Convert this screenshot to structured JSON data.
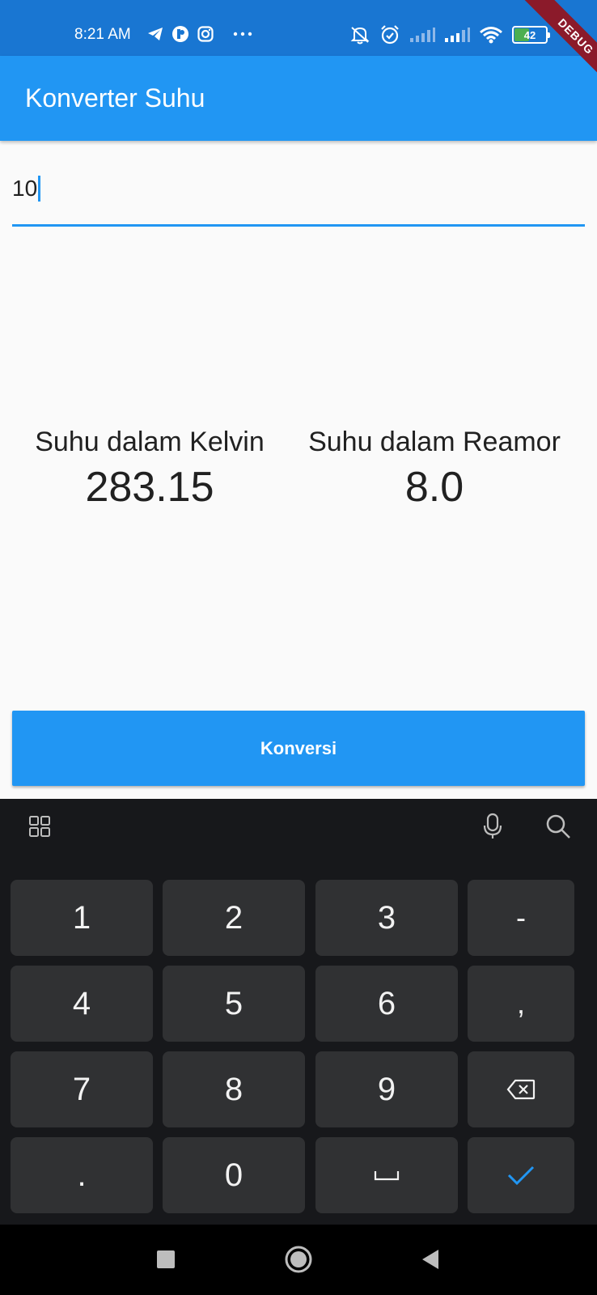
{
  "status_bar": {
    "time": "8:21 AM",
    "battery": "42",
    "left_icons": [
      "telegram-icon",
      "app-icon",
      "instagram-icon",
      "more-dots-icon"
    ],
    "right_icons": [
      "mute-icon",
      "alarm-icon",
      "signal-icon",
      "signal-icon",
      "wifi-icon",
      "battery-icon"
    ]
  },
  "debug_banner": "DEBUG",
  "app_bar": {
    "title": "Konverter Suhu"
  },
  "input": {
    "value": "10"
  },
  "results": {
    "kelvin_label": "Suhu dalam Kelvin",
    "kelvin_value": "283.15",
    "reamur_label": "Suhu dalam Reamor",
    "reamur_value": "8.0"
  },
  "convert_button": "Konversi",
  "keyboard": {
    "toolbar": [
      "grid-icon",
      "microphone-icon",
      "search-icon"
    ],
    "rows": [
      [
        "1",
        "2",
        "3",
        "-"
      ],
      [
        "4",
        "5",
        "6",
        ","
      ],
      [
        "7",
        "8",
        "9",
        "backspace-icon"
      ],
      [
        ".",
        "0",
        "space-icon",
        "check-icon"
      ]
    ],
    "colors": {
      "background": "#17181b",
      "key": "#303133",
      "accent": "#2196f3"
    }
  },
  "nav_bar": [
    "recents-icon",
    "home-icon",
    "back-icon"
  ],
  "colors": {
    "primary": "#2196f3",
    "status_bar": "#1976d2"
  }
}
